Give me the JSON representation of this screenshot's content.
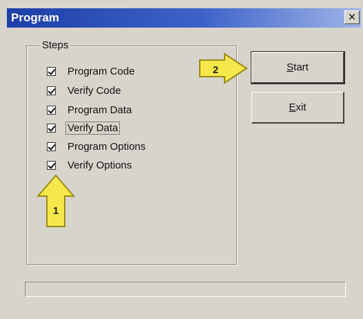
{
  "window": {
    "title": "Program",
    "close_glyph": "×",
    "bg_color": "#d7d4cc",
    "title_color": "#1c3fa8"
  },
  "steps": {
    "group_label": "Steps",
    "items": [
      {
        "label": "Program Code",
        "checked": true
      },
      {
        "label": "Verify Code",
        "checked": true
      },
      {
        "label": "Program Data",
        "checked": true
      },
      {
        "label": "Verify Data",
        "checked": true,
        "focused": true
      },
      {
        "label": "Program Options",
        "checked": true
      },
      {
        "label": "Verify Options",
        "checked": true
      }
    ]
  },
  "buttons": {
    "start_prefix": "",
    "start_mnemonic": "S",
    "start_rest": "tart",
    "exit_prefix": "",
    "exit_mnemonic": "E",
    "exit_rest": "xit"
  },
  "callouts": {
    "arrow1_number": "1",
    "arrow2_number": "2",
    "color": "#f5e84a"
  },
  "progress": {
    "value_percent": 0
  }
}
